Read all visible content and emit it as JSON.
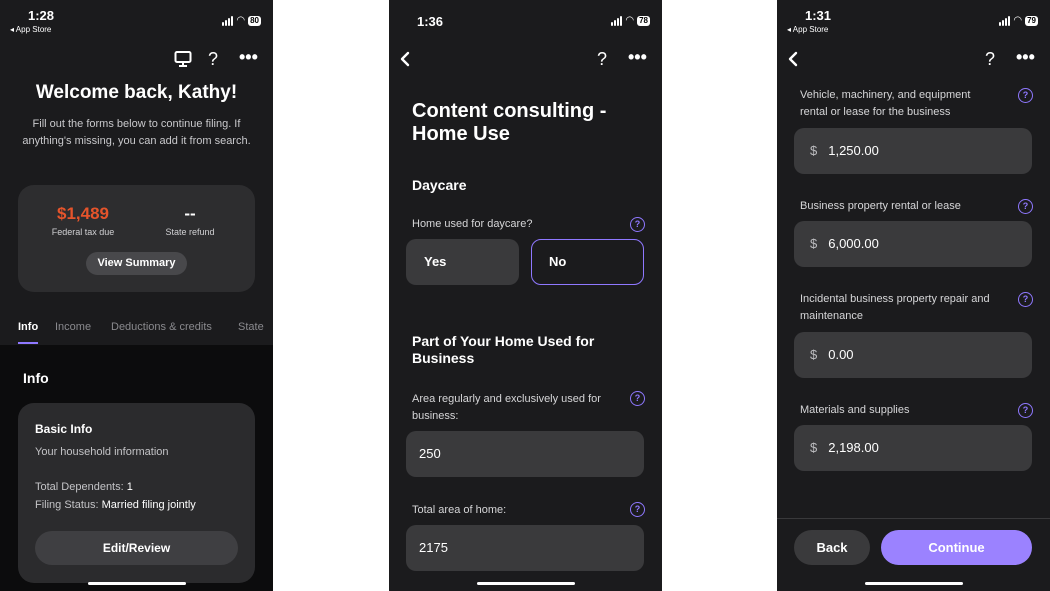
{
  "phone1": {
    "status": {
      "time": "1:28",
      "back_app": "◂ App Store",
      "battery": "80"
    },
    "welcome_title": "Welcome back, Kathy!",
    "welcome_sub": "Fill out the forms below to continue filing. If anything's missing, you can add it from search.",
    "summary": {
      "federal_value": "$1,489",
      "federal_label": "Federal tax due",
      "state_value": "--",
      "state_label": "State refund",
      "view_button": "View Summary"
    },
    "tabs": [
      "Info",
      "Income",
      "Deductions & credits",
      "State"
    ],
    "section_title": "Info",
    "basic_info": {
      "title": "Basic Info",
      "subtitle": "Your household information",
      "dependents_label": "Total Dependents: ",
      "dependents_value": "1",
      "filing_label": "Filing Status: ",
      "filing_value": "Married filing jointly",
      "edit_button": "Edit/Review"
    }
  },
  "phone2": {
    "status": {
      "time": "1:36",
      "battery": "78"
    },
    "title": "Content consulting - Home Use",
    "daycare_heading": "Daycare",
    "daycare_question": "Home used for daycare?",
    "yes_label": "Yes",
    "no_label": "No",
    "part_heading": "Part of Your Home Used for Business",
    "area_label": "Area regularly and exclusively used for business:",
    "area_value": "250",
    "total_label": "Total area of home:",
    "total_value": "2175"
  },
  "phone3": {
    "status": {
      "time": "1:31",
      "back_app": "◂ App Store",
      "battery": "79"
    },
    "currency": "$",
    "fields": [
      {
        "label": "Vehicle, machinery, and equipment rental or lease for the business",
        "value": "1,250.00"
      },
      {
        "label": "Business property rental or lease",
        "value": "6,000.00"
      },
      {
        "label": "Incidental business property repair and maintenance",
        "value": "0.00"
      },
      {
        "label": "Materials and supplies",
        "value": "2,198.00"
      }
    ],
    "back_button": "Back",
    "continue_button": "Continue"
  },
  "colors": {
    "accent": "#8f78ff",
    "tax_due": "#e5542b",
    "background": "#1b1b1d",
    "field": "#3a3a3c"
  }
}
